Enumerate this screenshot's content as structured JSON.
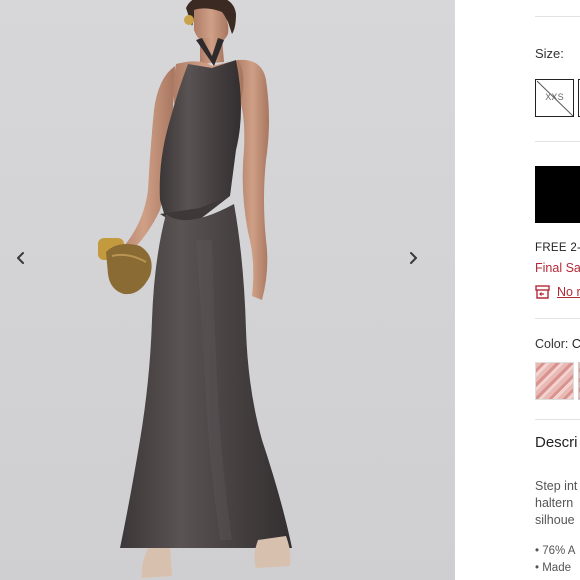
{
  "gallery": {
    "prev_icon": "chevron-left-icon",
    "next_icon": "chevron-right-icon"
  },
  "size": {
    "label": "Size:",
    "options": [
      "XXS"
    ]
  },
  "shipping": {
    "text": "FREE 2-I",
    "final_sale": "Final Sa",
    "return_icon": "return-box-icon",
    "return_link": "No r"
  },
  "color": {
    "label": "Color:",
    "value": "C",
    "swatch_colors": [
      "#e9b9b5",
      "#d9938f",
      "#f3d2cf"
    ]
  },
  "description": {
    "heading": "Descri",
    "lines": [
      "Step int",
      "haltern",
      "silhoue"
    ],
    "bullets": [
      "• 76% A",
      "• Made"
    ]
  },
  "colors": {
    "accent_red": "#b32a36",
    "cta_black": "#000000"
  }
}
